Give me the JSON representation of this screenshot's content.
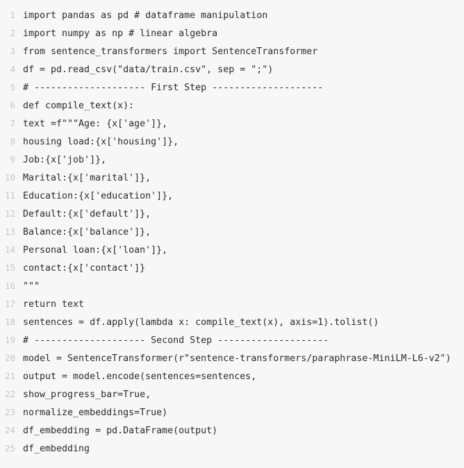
{
  "editor": {
    "language": "python",
    "background_color": "#f7f7f7",
    "text_color": "#2b2b2b",
    "line_number_color": "#c6c6c6",
    "first_line_number": 1,
    "last_line_number": 25,
    "total_lines": 25
  },
  "code_lines": [
    {
      "number": "1",
      "text": "import pandas as pd # dataframe manipulation"
    },
    {
      "number": "2",
      "text": "import numpy as np # linear algebra"
    },
    {
      "number": "3",
      "text": "from sentence_transformers import SentenceTransformer"
    },
    {
      "number": "4",
      "text": "df = pd.read_csv(\"data/train.csv\", sep = \";\")"
    },
    {
      "number": "5",
      "text": "# -------------------- First Step --------------------"
    },
    {
      "number": "6",
      "text": "def compile_text(x):"
    },
    {
      "number": "7",
      "text": "text =f\"\"\"Age: {x['age']},"
    },
    {
      "number": "8",
      "text": "housing load:{x['housing']},"
    },
    {
      "number": "9",
      "text": "Job:{x['job']},"
    },
    {
      "number": "10",
      "text": "Marital:{x['marital']},"
    },
    {
      "number": "11",
      "text": "Education:{x['education']},"
    },
    {
      "number": "12",
      "text": "Default:{x['default']},"
    },
    {
      "number": "13",
      "text": "Balance:{x['balance']},"
    },
    {
      "number": "14",
      "text": "Personal loan:{x['loan']},"
    },
    {
      "number": "15",
      "text": "contact:{x['contact']}"
    },
    {
      "number": "16",
      "text": "\"\"\""
    },
    {
      "number": "17",
      "text": "return text"
    },
    {
      "number": "18",
      "text": "sentences = df.apply(lambda x: compile_text(x), axis=1).tolist()"
    },
    {
      "number": "19",
      "text": "# -------------------- Second Step --------------------"
    },
    {
      "number": "20",
      "text": "model = SentenceTransformer(r\"sentence-transformers/paraphrase-MiniLM-L6-v2\")"
    },
    {
      "number": "21",
      "text": "output = model.encode(sentences=sentences,"
    },
    {
      "number": "22",
      "text": "show_progress_bar=True,"
    },
    {
      "number": "23",
      "text": "normalize_embeddings=True)"
    },
    {
      "number": "24",
      "text": "df_embedding = pd.DataFrame(output)"
    },
    {
      "number": "25",
      "text": "df_embedding"
    }
  ]
}
